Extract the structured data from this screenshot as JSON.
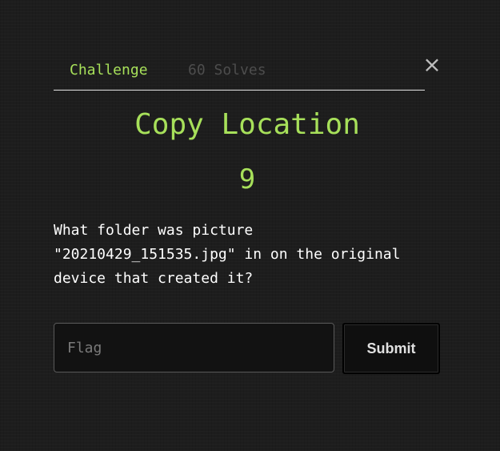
{
  "tabs": {
    "challenge_label": "Challenge",
    "solves_label": "60 Solves"
  },
  "close_icon": "×",
  "challenge": {
    "title": "Copy Location",
    "value": "9",
    "description": "What folder was picture\n\"20210429_151535.jpg\" in on the original\ndevice that created it?"
  },
  "form": {
    "flag_placeholder": "Flag",
    "flag_value": "",
    "submit_label": "Submit"
  },
  "colors": {
    "accent": "#a7e05a",
    "background": "#1d1d1d",
    "muted": "#4d4d4d"
  }
}
